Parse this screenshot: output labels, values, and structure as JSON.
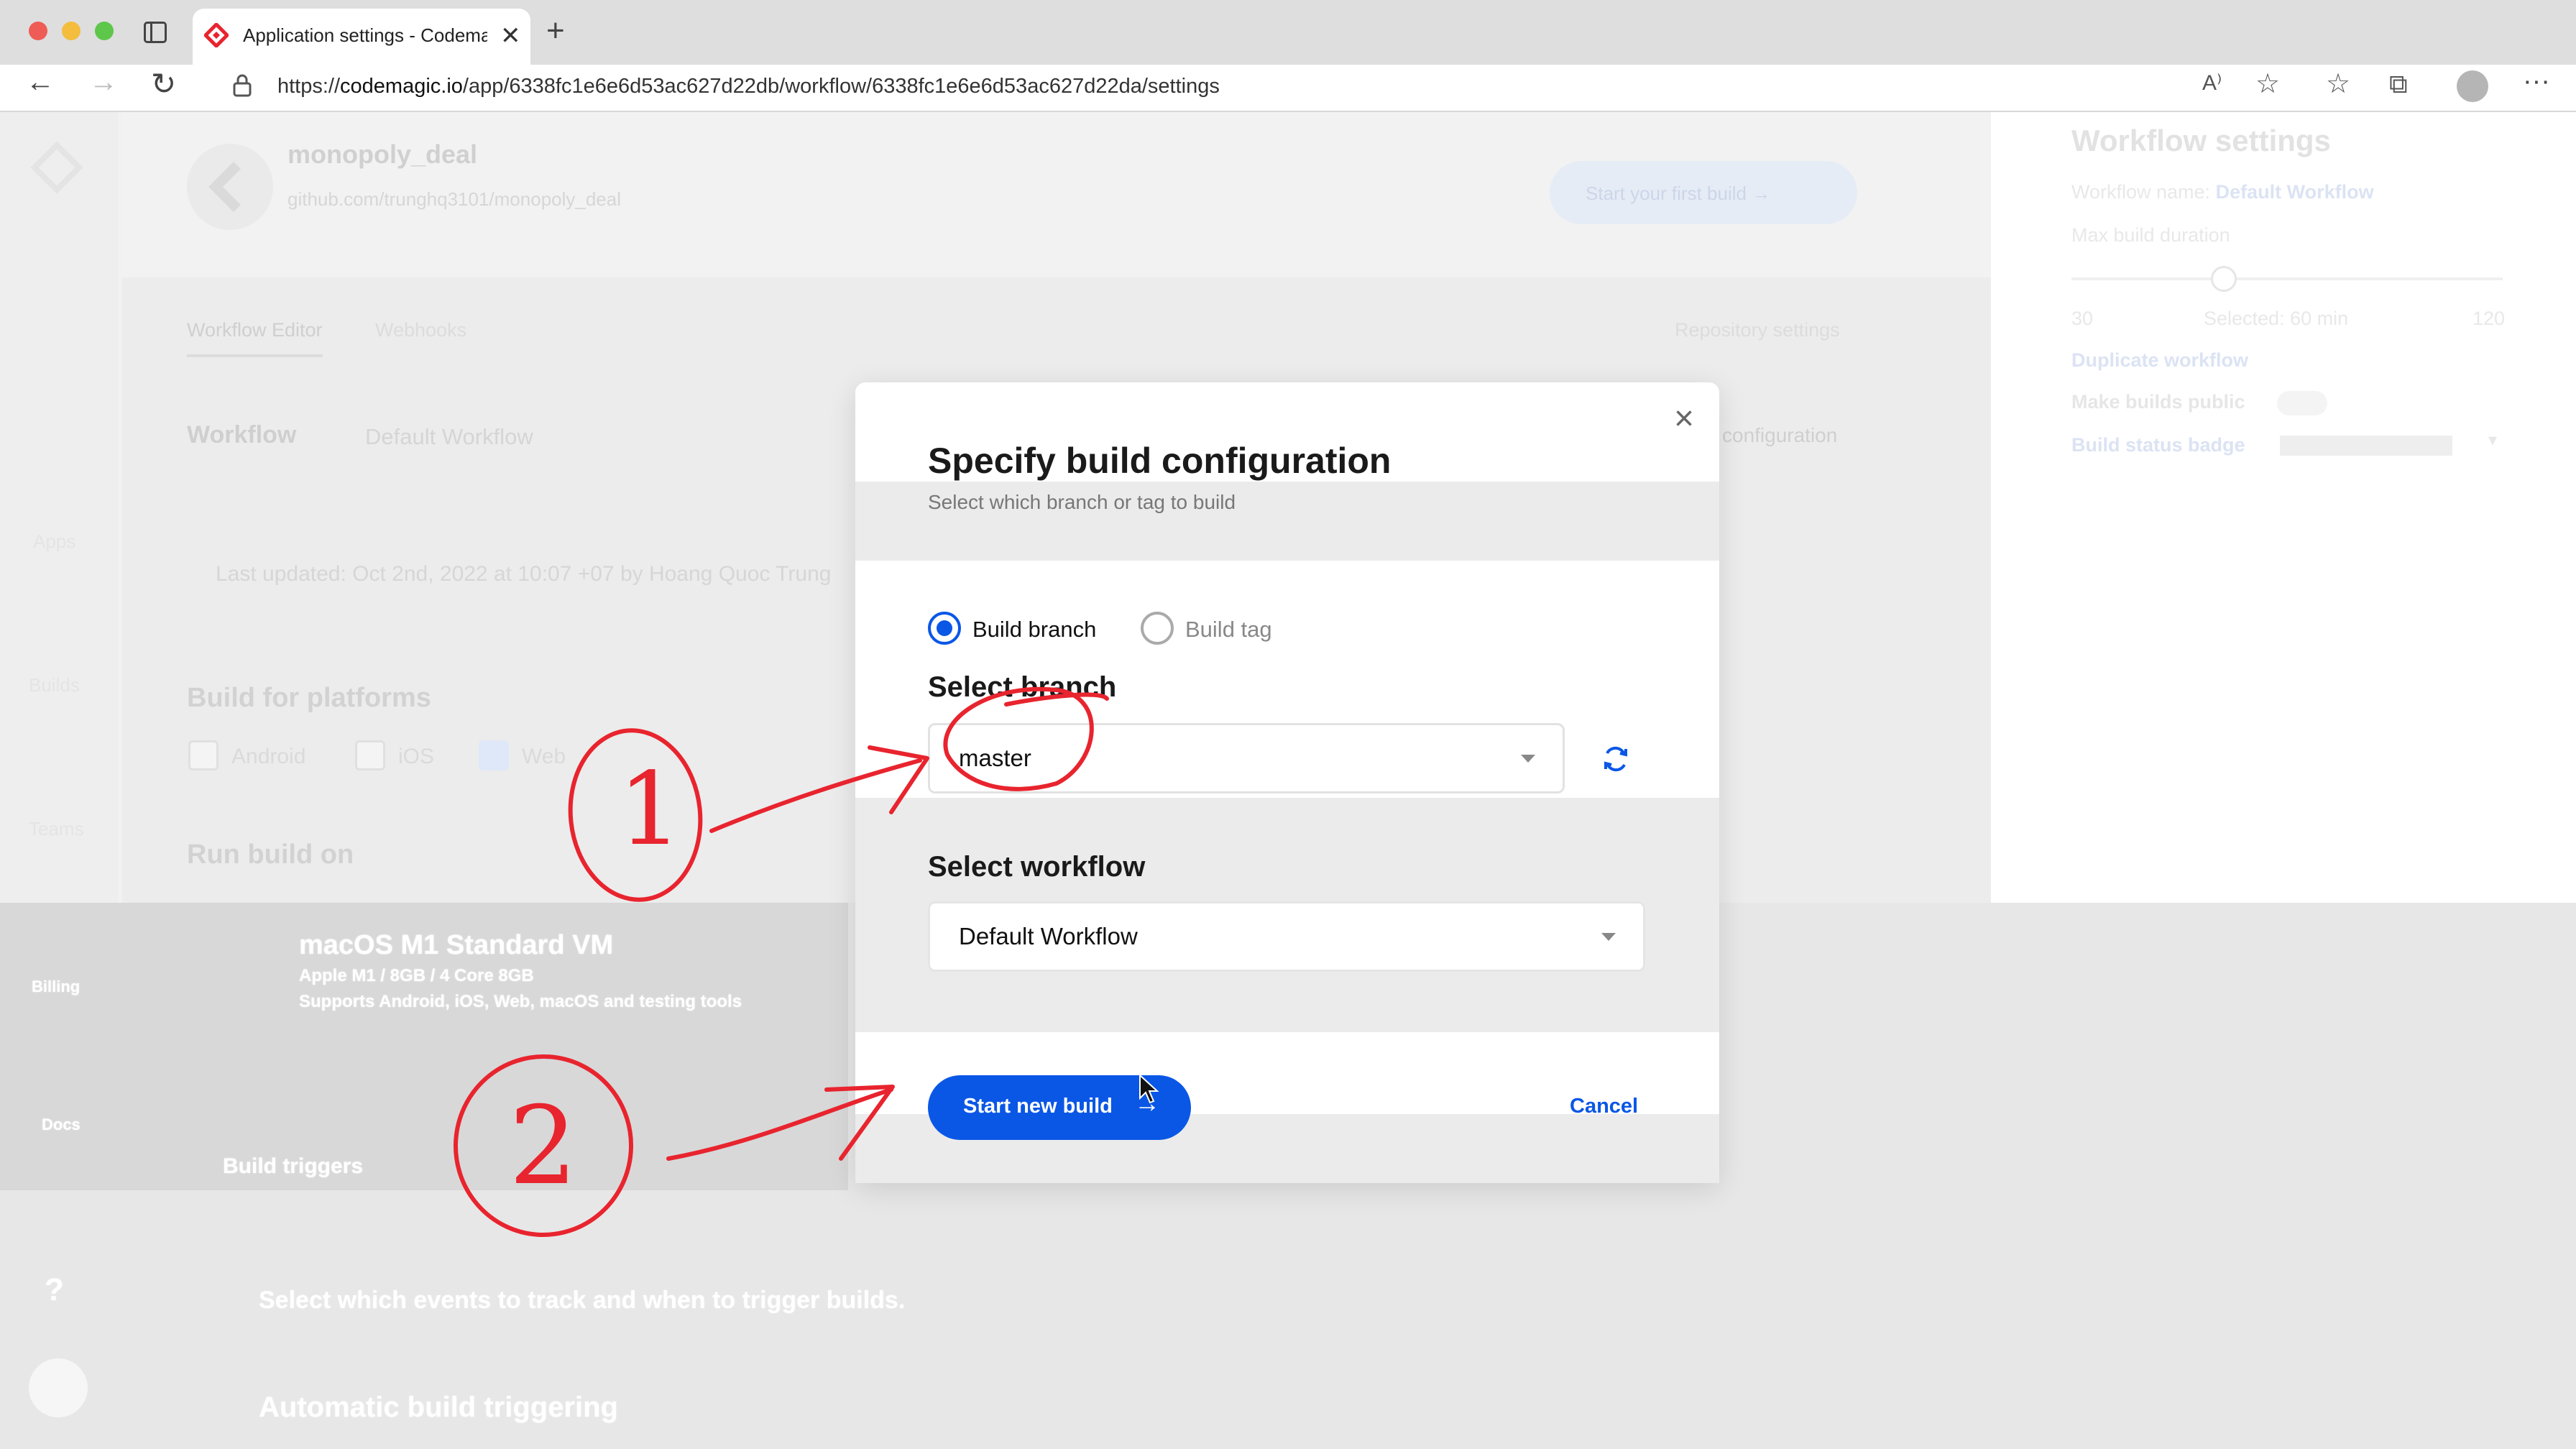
{
  "browser": {
    "tab_title": "Application settings - Codema",
    "url_prefix": "https://",
    "url_host": "codemagic.io",
    "url_path": "/app/6338fc1e6e6d53ac627d22db/workflow/6338fc1e6e6d53ac627d22da/settings"
  },
  "background": {
    "app_name": "monopoly_deal",
    "repo": "github.com/trunghq3101/monopoly_deal",
    "start_first_build": "Start your first build",
    "tabs": [
      "Workflow Editor",
      "Webhooks"
    ],
    "repository_settings": "Repository settings",
    "workflow_label": "Workflow",
    "workflow_select": "Default Workflow",
    "configuration": "configuration",
    "last_updated": "Last updated: Oct 2nd, 2022 at 10:07 +07 by Hoang Quoc Trung",
    "build_for_platforms": "Build for platforms",
    "platforms": [
      "Android",
      "iOS",
      "Web"
    ],
    "run_build_on": "Run build on",
    "instance_name": "macOS M1 Standard VM",
    "instance_desc1": "Apple M1 / 8GB / 4 Core 8GB",
    "instance_desc2": "Supports Android, iOS, Web, macOS and testing tools",
    "instance": "instance",
    "build_triggers": "Build triggers",
    "trigger_desc": "Select which events to track and when to trigger builds.",
    "automatic_triggering": "Automatic build triggering",
    "left_nav": [
      "Apps",
      "Builds",
      "Teams",
      "Billing",
      "Docs"
    ]
  },
  "settings_panel": {
    "title": "Workflow settings",
    "workflow_name_label": "Workflow name:",
    "workflow_name": "Default Workflow",
    "max_duration": "Max build duration",
    "slider_min": "30",
    "slider_selected": "Selected: 60 min",
    "slider_max": "120",
    "duplicate": "Duplicate workflow",
    "make_public": "Make builds public",
    "status_badge": "Build status badge"
  },
  "modal": {
    "title": "Specify build configuration",
    "subtitle": "Select which branch or tag to build",
    "radio_branch": "Build branch",
    "radio_tag": "Build tag",
    "select_branch_label": "Select branch",
    "branch_value": "master",
    "select_workflow_label": "Select workflow",
    "workflow_value": "Default Workflow",
    "start_button": "Start new build",
    "cancel_button": "Cancel"
  },
  "annotations": {
    "marker_1": "1",
    "marker_2": "2"
  },
  "colors": {
    "accent": "#0a57e6",
    "annotation_red": "#e8242e"
  }
}
